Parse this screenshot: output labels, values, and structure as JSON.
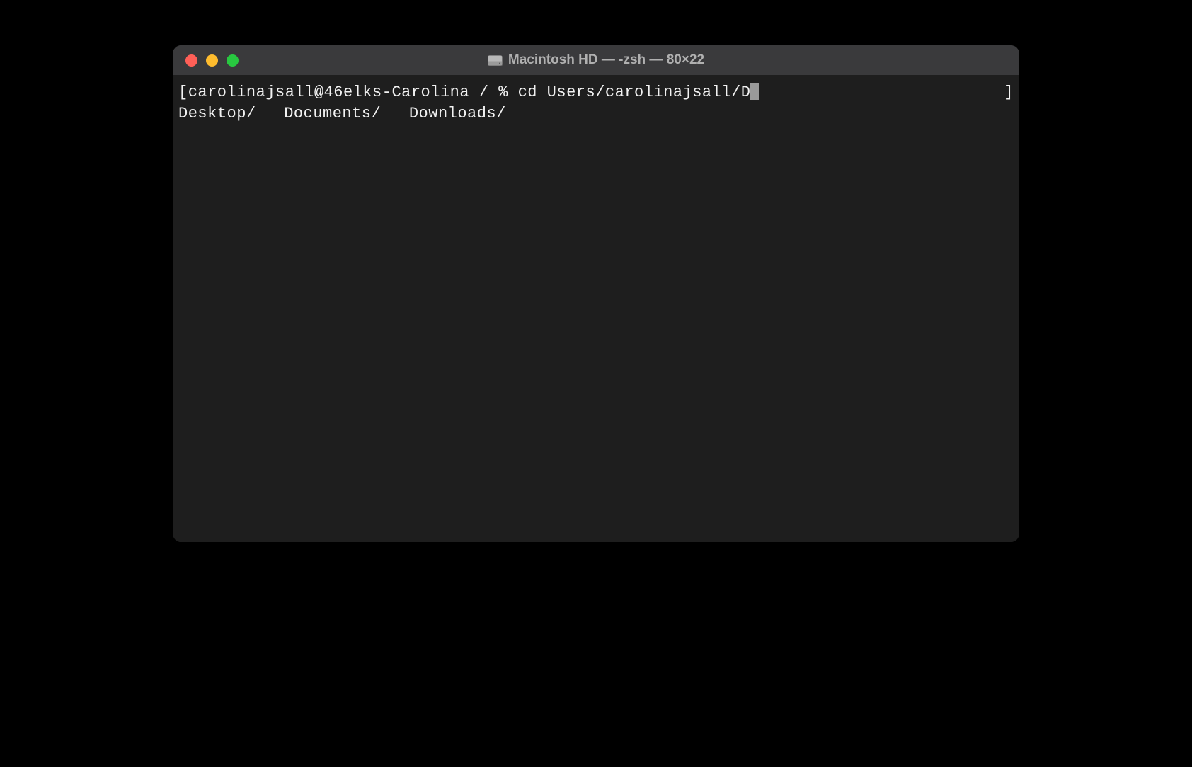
{
  "window": {
    "title": "Macintosh HD — -zsh — 80×22"
  },
  "terminal": {
    "prompt_open_bracket": "[",
    "prompt_text": "carolinajsall@46elks-Carolina / % ",
    "command": "cd Users/carolinajsall/D",
    "prompt_close_bracket": "]",
    "completions": [
      "Desktop/",
      "Documents/",
      "Downloads/"
    ]
  }
}
